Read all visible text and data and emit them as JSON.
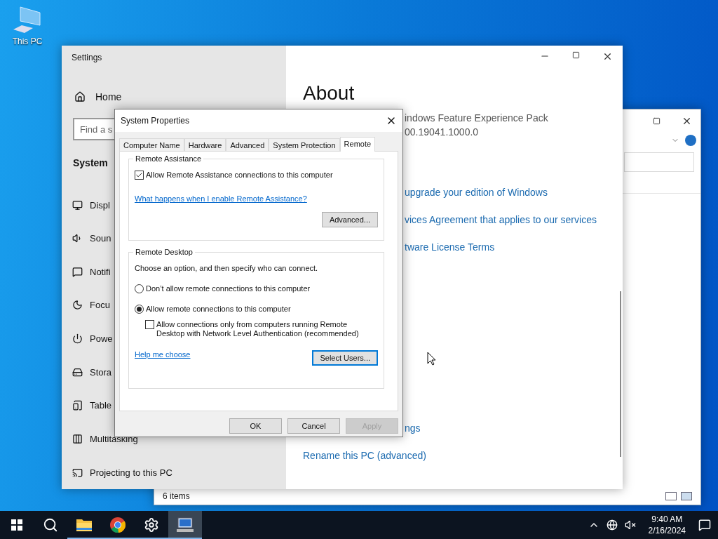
{
  "desktop_icons": [
    {
      "label": "This PC"
    }
  ],
  "explorer": {
    "status": "6 items"
  },
  "settings": {
    "title": "Settings",
    "home": "Home",
    "search_placeholder": "Find a s",
    "section": "System",
    "items": [
      {
        "label": "Displ"
      },
      {
        "label": "Soun"
      },
      {
        "label": "Notifi"
      },
      {
        "label": "Focu"
      },
      {
        "label": "Powe"
      },
      {
        "label": "Stora"
      },
      {
        "label": "Table"
      },
      {
        "label": "Multitasking"
      },
      {
        "label": "Projecting to this PC"
      }
    ],
    "heading": "About",
    "groups": [
      {
        "lines": [
          {
            "text": "indows Feature Experience Pack",
            "kind": "cut-text"
          },
          {
            "text": "00.19041.1000.0",
            "kind": "cut-text"
          }
        ]
      },
      {
        "lines": [
          {
            "text": "upgrade your edition of Windows",
            "kind": "cut-link"
          },
          {
            "text": "vices Agreement that applies to our services",
            "kind": "cut-link"
          },
          {
            "text": "tware License Terms",
            "kind": "cut-link"
          }
        ]
      },
      {
        "lines": [
          {
            "text": "ngs",
            "kind": "cut-link"
          },
          {
            "text": "Rename this PC (advanced)",
            "kind": "link"
          }
        ]
      }
    ]
  },
  "dialog": {
    "title": "System Properties",
    "tabs": [
      {
        "label": "Computer Name",
        "selected": false
      },
      {
        "label": "Hardware",
        "selected": false
      },
      {
        "label": "Advanced",
        "selected": false
      },
      {
        "label": "System Protection",
        "selected": false
      },
      {
        "label": "Remote",
        "selected": true
      }
    ],
    "remote_assistance": {
      "legend": "Remote Assistance",
      "allow": {
        "label": "Allow Remote Assistance connections to this computer",
        "checked": true
      },
      "link": "What happens when I enable Remote Assistance?",
      "button": "Advanced..."
    },
    "remote_desktop": {
      "legend": "Remote Desktop",
      "instruction": "Choose an option, and then specify who can connect.",
      "options": [
        {
          "label": "Don’t allow remote connections to this computer",
          "selected": false
        },
        {
          "label": "Allow remote connections to this computer",
          "selected": true
        }
      ],
      "nla": {
        "label": "Allow connections only from computers running Remote Desktop with Network Level Authentication (recommended)",
        "checked": false
      },
      "link": "Help me choose",
      "button": "Select Users..."
    },
    "buttons": [
      {
        "label": "OK",
        "disabled": false
      },
      {
        "label": "Cancel",
        "disabled": false
      },
      {
        "label": "Apply",
        "disabled": true
      }
    ]
  },
  "taskbar": {
    "apps": [
      {
        "kind": "explorer",
        "running": true,
        "active": false
      },
      {
        "kind": "browser",
        "running": true,
        "active": false
      },
      {
        "kind": "settings",
        "running": true,
        "active": false
      },
      {
        "kind": "system",
        "running": true,
        "active": true
      }
    ],
    "time": "9:40 AM",
    "date": "2/16/2024"
  }
}
